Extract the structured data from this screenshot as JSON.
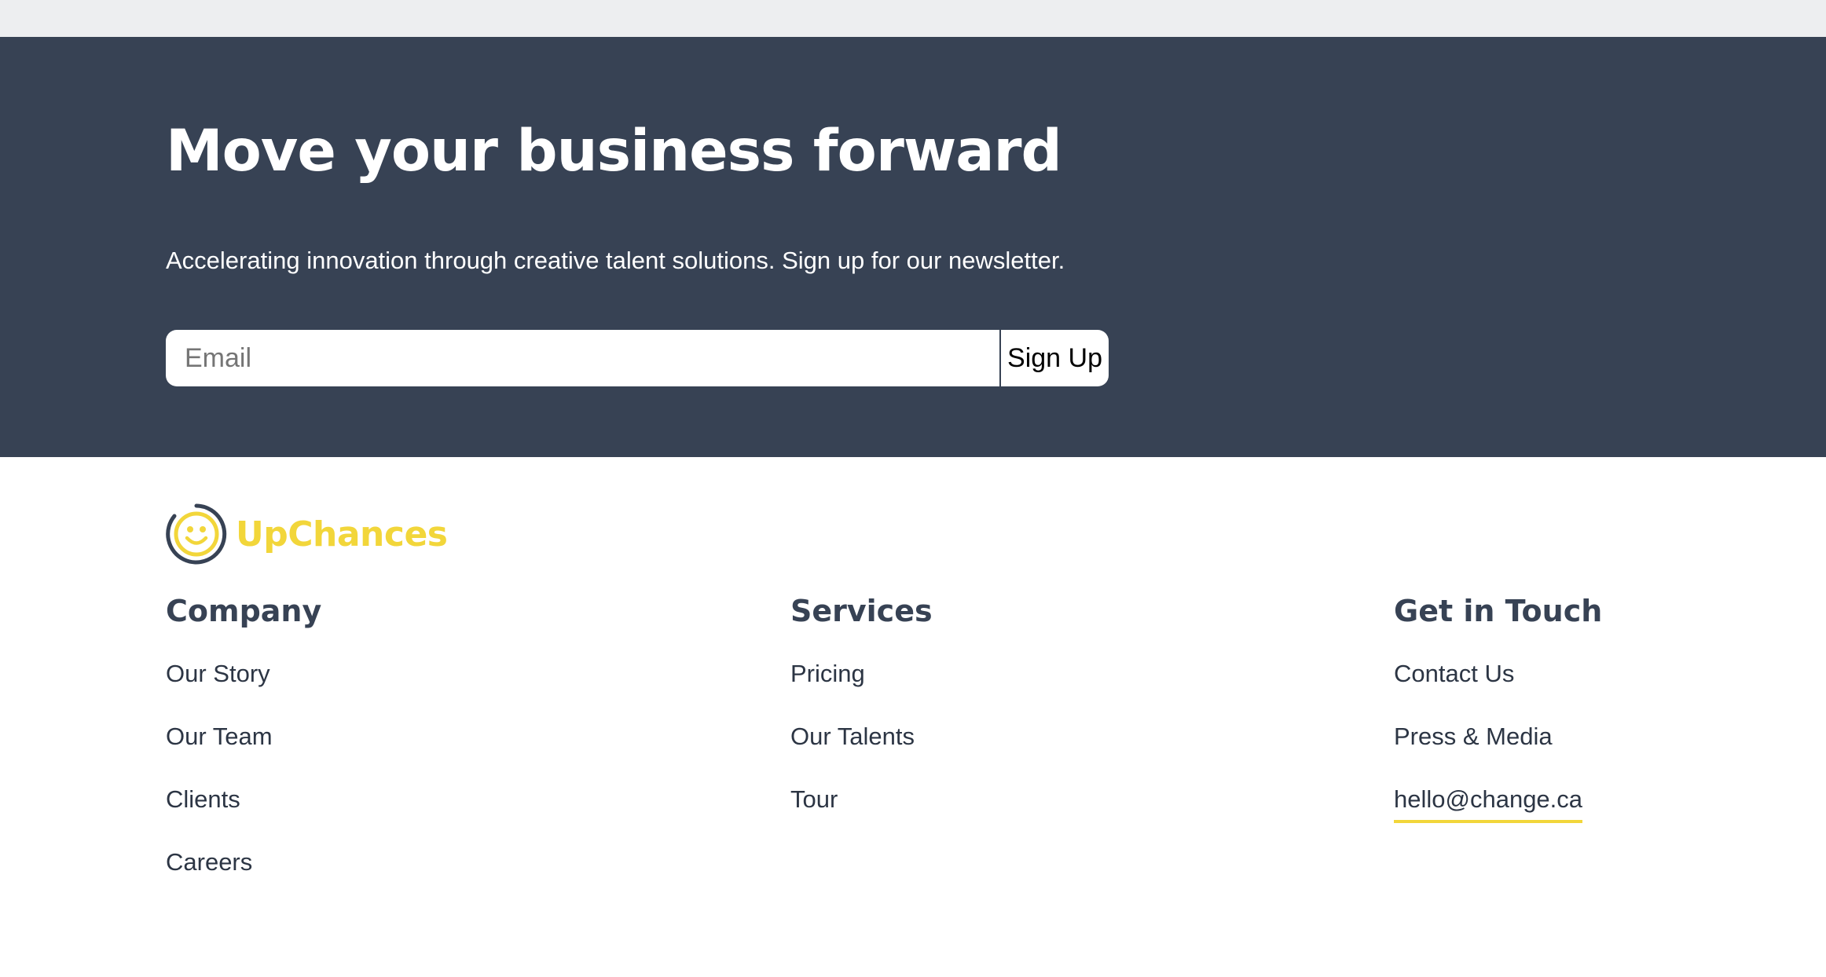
{
  "hero": {
    "title": "Move your business forward",
    "subtitle": "Accelerating innovation through creative talent solutions. Sign up for our newsletter.",
    "email_placeholder": "Email",
    "signup_label": "Sign Up"
  },
  "brand": {
    "name": "UpChances",
    "logo_icon": "smiley-face-icon",
    "color": "#f2d63a"
  },
  "footer": {
    "company": {
      "heading": "Company",
      "links": [
        "Our Story",
        "Our Team",
        "Clients",
        "Careers"
      ]
    },
    "services": {
      "heading": "Services",
      "links": [
        "Pricing",
        "Our Talents",
        "Tour"
      ]
    },
    "contact": {
      "heading": "Get in Touch",
      "links": [
        "Contact Us",
        "Press & Media",
        "hello@change.ca"
      ]
    }
  },
  "colors": {
    "hero_bg": "#374254",
    "top_bar": "#edeef0",
    "accent": "#f2d63a",
    "text_dark": "#374254"
  }
}
